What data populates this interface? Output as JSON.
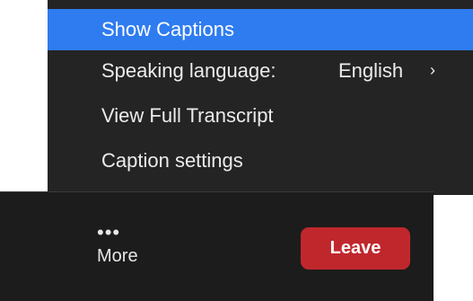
{
  "menu": {
    "items": [
      {
        "label": "Show Captions",
        "highlighted": true
      },
      {
        "label": "Speaking language:",
        "value": "English",
        "icon": "chevron-right-icon"
      },
      {
        "label": "View Full Transcript"
      },
      {
        "label": "Caption settings"
      }
    ]
  },
  "toolbar": {
    "more_icon": "ellipsis-icon",
    "more_label": "More",
    "leave_label": "Leave"
  },
  "colors": {
    "menu_bg": "#242424",
    "highlight": "#2f7cf0",
    "toolbar_bg": "#1c1c1c",
    "leave_bg": "#c0272d"
  }
}
